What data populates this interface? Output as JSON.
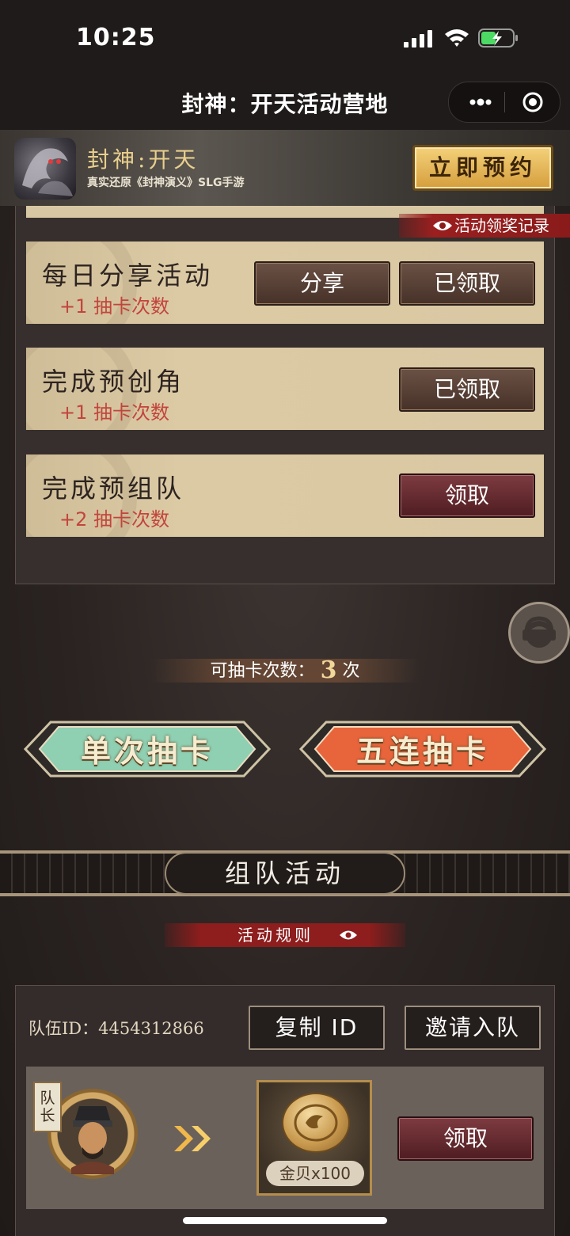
{
  "status_bar": {
    "time": "10:25"
  },
  "nav": {
    "title": "封神：开天活动营地"
  },
  "promo": {
    "title": "封神:开天",
    "subtitle": "真实还原《封神演义》SLG手游",
    "reserve_label": "立即预约"
  },
  "record_link": "活动领奖记录",
  "tasks": [
    {
      "name": "每日分享活动",
      "reward": "+1 抽卡次数",
      "share_label": "分享",
      "claim_label": "已领取"
    },
    {
      "name": "完成预创角",
      "reward": "+1 抽卡次数",
      "claim_label": "已领取"
    },
    {
      "name": "完成预组队",
      "reward": "+2 抽卡次数",
      "claim_label": "领取"
    }
  ],
  "draw": {
    "count_prefix": "可抽卡次数：",
    "count": "3",
    "count_suffix": "次",
    "single_label": "单次抽卡",
    "five_label": "五连抽卡"
  },
  "team": {
    "title": "组队活动",
    "rules_label": "活动规则",
    "id_label": "队伍ID：",
    "id_value": "4454312866",
    "copy_label": "复制 ID",
    "invite_label": "邀请入队",
    "captain_tag": "队长",
    "reward_label": "金贝x100",
    "claim_label": "领取"
  },
  "colors": {
    "accent_gold": "#e9cf8e",
    "reward_red": "#c2453d",
    "card_bg": "#dac8a3",
    "single_draw_green": "#8fcfb2",
    "five_draw_orange": "#e8653c"
  },
  "icons": {
    "signal": "signal-icon",
    "wifi": "wifi-icon",
    "battery": "battery-charging-icon",
    "more": "more-dots-icon",
    "close": "close-target-icon",
    "eye": "eye-icon",
    "support": "customer-service-icon",
    "arrow": "double-chevron-right-icon",
    "coin": "gold-coin-icon"
  }
}
